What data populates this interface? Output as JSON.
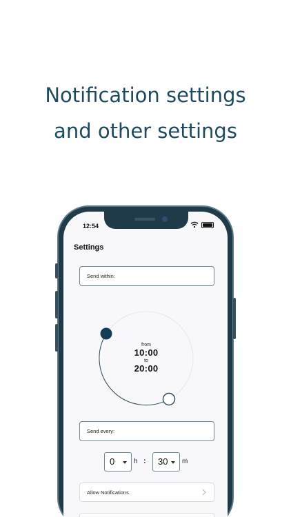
{
  "headline": {
    "line1": "Notification settings",
    "line2": "and other settings"
  },
  "status_bar": {
    "time": "12:54",
    "wifi_icon": "wifi-icon",
    "battery_icon": "battery-icon"
  },
  "settings": {
    "title": "Settings",
    "send_within_label": "Send within:",
    "window": {
      "from_label": "from",
      "from_time": "10:00",
      "to_label": "to",
      "to_time": "20:00"
    },
    "send_every_label": "Send every:",
    "interval": {
      "hours": "0",
      "hours_unit": "h",
      "separator": ":",
      "minutes": "30",
      "minutes_unit": "m"
    },
    "allow_notifications_label": "Allow Notifications",
    "colors": {
      "accent": "#1d4a5f",
      "knob": "#173e56"
    }
  }
}
